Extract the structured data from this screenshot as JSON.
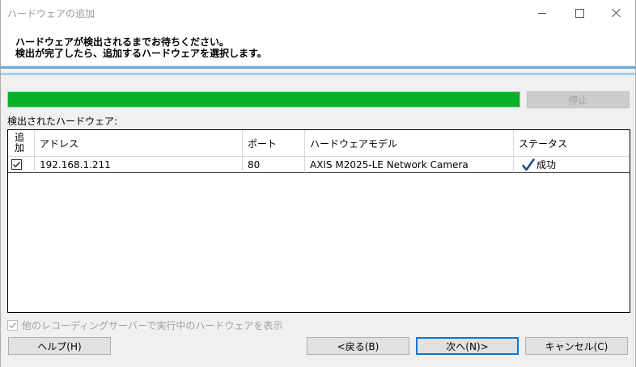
{
  "window": {
    "title": "ハードウェアの追加"
  },
  "header": {
    "line1": "ハードウェアが検出されるまでお待ちください。",
    "line2": "検出が完了したら、追加するハードウェアを選択します。"
  },
  "progress": {
    "value_percent": 100,
    "stop_label": "停止"
  },
  "detected_label": "検出されたハードウェア:",
  "table": {
    "columns": {
      "add_line1": "追",
      "add_line2": "加",
      "address": "アドレス",
      "port": "ポート",
      "model": "ハードウェアモデル",
      "status": "ステータス"
    },
    "rows": [
      {
        "checked": true,
        "address": "192.168.1.211",
        "port": "80",
        "model": "AXIS M2025-LE Network Camera",
        "status": "成功"
      }
    ]
  },
  "show_other_label": "他のレコーディングサーバーで実行中のハードウェアを表示",
  "buttons": {
    "help": "ヘルプ(H)",
    "back": "<戻る(B)",
    "next": "次へ(N)>",
    "cancel": "キャンセル(C)"
  },
  "colors": {
    "progress": "#06b025",
    "accent_blue": "#0078d7",
    "status_check": "#1f4e8c"
  }
}
